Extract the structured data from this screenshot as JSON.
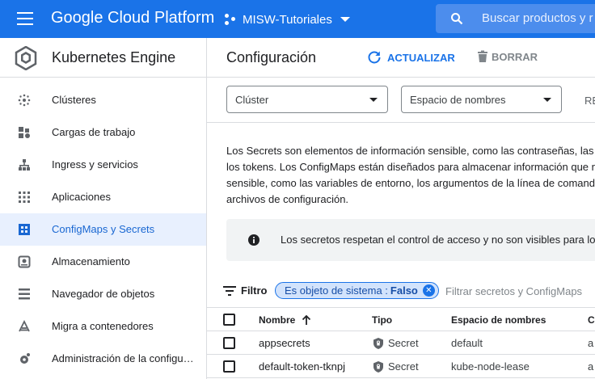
{
  "header": {
    "brand": "Google Cloud Platform",
    "project": "MISW-Tutoriales",
    "search_placeholder": "Buscar productos y r"
  },
  "sidebar": {
    "product": "Kubernetes Engine",
    "items": [
      {
        "label": "Clústeres",
        "icon": "clusters-icon"
      },
      {
        "label": "Cargas de trabajo",
        "icon": "workloads-icon"
      },
      {
        "label": "Ingress y servicios",
        "icon": "services-icon"
      },
      {
        "label": "Aplicaciones",
        "icon": "applications-icon"
      },
      {
        "label": "ConfigMaps y Secrets",
        "icon": "configmaps-icon",
        "active": true
      },
      {
        "label": "Almacenamiento",
        "icon": "storage-icon"
      },
      {
        "label": "Navegador de objetos",
        "icon": "object-browser-icon"
      },
      {
        "label": "Migra a contenedores",
        "icon": "migrate-icon"
      },
      {
        "label": "Administración de la configu…",
        "icon": "config-management-icon"
      }
    ]
  },
  "main": {
    "title": "Configuración",
    "refresh_label": "ACTUALIZAR",
    "delete_label": "BORRAR",
    "cluster_select": "Clúster",
    "namespace_select": "Espacio de nombres",
    "reset_label": "RE",
    "description": [
      "Los Secrets son elementos de información sensible, como las contraseñas, las",
      "los tokens. Los ConfigMaps están diseñados para almacenar información que n",
      "sensible, como las variables de entorno, los argumentos de la línea de comando",
      "archivos de configuración."
    ],
    "info_banner": "Los secretos respetan el control de acceso y no son visibles para lo"
  },
  "filter": {
    "label": "Filtro",
    "chip_key": "Es objeto de sistema :",
    "chip_value": "Falso",
    "placeholder": "Filtrar secretos y ConfigMaps"
  },
  "table": {
    "columns": [
      "Nombre",
      "Tipo",
      "Espacio de nombres",
      "C"
    ],
    "rows": [
      {
        "name": "appsecrets",
        "type": "Secret",
        "namespace": "default",
        "extra": "a"
      },
      {
        "name": "default-token-tknpj",
        "type": "Secret",
        "namespace": "kube-node-lease",
        "extra": "a"
      }
    ]
  },
  "colors": {
    "topbar": "#1a73e8",
    "active_nav_bg": "#e8f0fe",
    "active_nav_text": "#1967d2",
    "chip_bg": "#d2e3fc"
  }
}
